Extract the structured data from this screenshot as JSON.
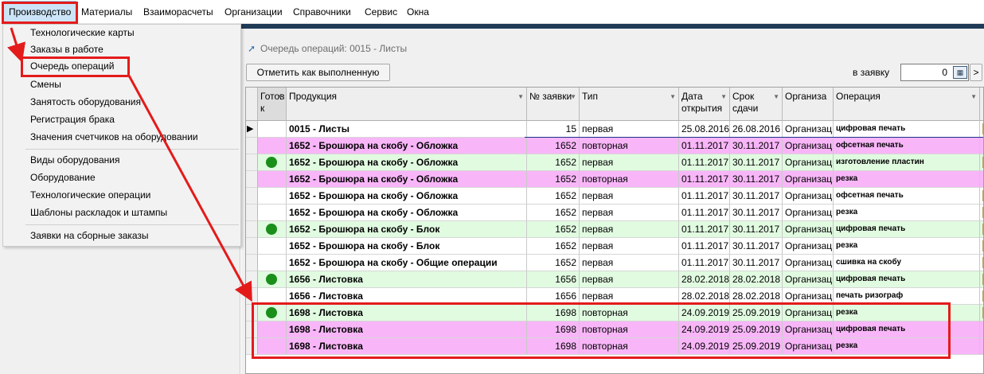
{
  "menubar": {
    "items": [
      "Производство",
      "Материалы",
      "Взаиморасчеты",
      "Организации",
      "Справочники",
      "Сервис",
      "Окна"
    ]
  },
  "dropdown": {
    "group1": [
      "Технологические карты",
      "Заказы в работе",
      "Очередь операций",
      "Смены",
      "Занятость оборудования",
      "Регистрация брака",
      "Значения счетчиков на оборудовании"
    ],
    "group2": [
      "Виды оборудования",
      "Оборудование",
      "Технологические операции",
      "Шаблоны раскладок и штампы"
    ],
    "group3": [
      "Заявки на сборные заказы"
    ]
  },
  "form": {
    "title": "Очередь операций: 0015 - Листы",
    "mark_done_button": "Отметить как выполненную",
    "request_label": "в заявку",
    "request_value": "0",
    "next_button": ">"
  },
  "grid": {
    "headers": [
      "Готов к",
      "Продукция",
      "№ заявки",
      "Тип",
      "Дата открытия",
      "Срок сдачи",
      "Организа",
      "Операция"
    ],
    "rows": [
      {
        "ready": false,
        "product": "0015 - Листы",
        "num": "15",
        "type": "первая",
        "date_open": "25.08.2016",
        "date_due": "26.08.2016",
        "org": "Организация",
        "operation": "цифровая печать",
        "color": "#ffffff",
        "current": true
      },
      {
        "ready": false,
        "product": "1652 - Брошюра на скобу - Обложка",
        "num": "1652",
        "type": "повторная",
        "date_open": "01.11.2017",
        "date_due": "30.11.2017",
        "org": "Организация",
        "operation": "офсетная печать",
        "color": "#f8b6f8",
        "current": false
      },
      {
        "ready": true,
        "product": "1652 - Брошюра на скобу - Обложка",
        "num": "1652",
        "type": "первая",
        "date_open": "01.11.2017",
        "date_due": "30.11.2017",
        "org": "Организация",
        "operation": "изготовление пластин",
        "color": "#e1fbe1",
        "current": false
      },
      {
        "ready": false,
        "product": "1652 - Брошюра на скобу - Обложка",
        "num": "1652",
        "type": "повторная",
        "date_open": "01.11.2017",
        "date_due": "30.11.2017",
        "org": "Организация",
        "operation": "резка",
        "color": "#f8b6f8",
        "current": false
      },
      {
        "ready": false,
        "product": "1652 - Брошюра на скобу - Обложка",
        "num": "1652",
        "type": "первая",
        "date_open": "01.11.2017",
        "date_due": "30.11.2017",
        "org": "Организация",
        "operation": "офсетная печать",
        "color": "#ffffff",
        "current": false
      },
      {
        "ready": false,
        "product": "1652 - Брошюра на скобу - Обложка",
        "num": "1652",
        "type": "первая",
        "date_open": "01.11.2017",
        "date_due": "30.11.2017",
        "org": "Организация",
        "operation": "резка",
        "color": "#ffffff",
        "current": false
      },
      {
        "ready": true,
        "product": "1652 - Брошюра на скобу - Блок",
        "num": "1652",
        "type": "первая",
        "date_open": "01.11.2017",
        "date_due": "30.11.2017",
        "org": "Организация",
        "operation": "цифровая печать",
        "color": "#e1fbe1",
        "current": false
      },
      {
        "ready": false,
        "product": "1652 - Брошюра на скобу - Блок",
        "num": "1652",
        "type": "первая",
        "date_open": "01.11.2017",
        "date_due": "30.11.2017",
        "org": "Организация",
        "operation": "резка",
        "color": "#ffffff",
        "current": false
      },
      {
        "ready": false,
        "product": "1652 - Брошюра на скобу - Общие операции",
        "num": "1652",
        "type": "первая",
        "date_open": "01.11.2017",
        "date_due": "30.11.2017",
        "org": "Организация",
        "operation": "сшивка на скобу",
        "color": "#ffffff",
        "current": false
      },
      {
        "ready": true,
        "product": "1656 - Листовка",
        "num": "1656",
        "type": "первая",
        "date_open": "28.02.2018",
        "date_due": "28.02.2018",
        "org": "Организация",
        "operation": "цифровая печать",
        "color": "#e1fbe1",
        "current": false
      },
      {
        "ready": false,
        "product": "1656 - Листовка",
        "num": "1656",
        "type": "первая",
        "date_open": "28.02.2018",
        "date_due": "28.02.2018",
        "org": "Организация",
        "operation": "печать ризограф",
        "color": "#ffffff",
        "current": false
      },
      {
        "ready": true,
        "product": "1698 - Листовка",
        "num": "1698",
        "type": "повторная",
        "date_open": "24.09.2019",
        "date_due": "25.09.2019",
        "org": "Организация",
        "operation": "резка",
        "color": "#e1fbe1",
        "current": false
      },
      {
        "ready": false,
        "product": "1698 - Листовка",
        "num": "1698",
        "type": "повторная",
        "date_open": "24.09.2019",
        "date_due": "25.09.2019",
        "org": "Организация",
        "operation": "цифровая печать",
        "color": "#f8b6f8",
        "current": false
      },
      {
        "ready": false,
        "product": "1698 - Листовка",
        "num": "1698",
        "type": "повторная",
        "date_open": "24.09.2019",
        "date_due": "25.09.2019",
        "org": "Организация",
        "operation": "резка",
        "color": "#f8b6f8",
        "current": false
      }
    ]
  },
  "colors": {
    "highlight_red": "#e41b1b",
    "row_green": "#e1fbe1",
    "row_pink": "#f8b6f8",
    "ready_dot": "#1a8f1a"
  }
}
